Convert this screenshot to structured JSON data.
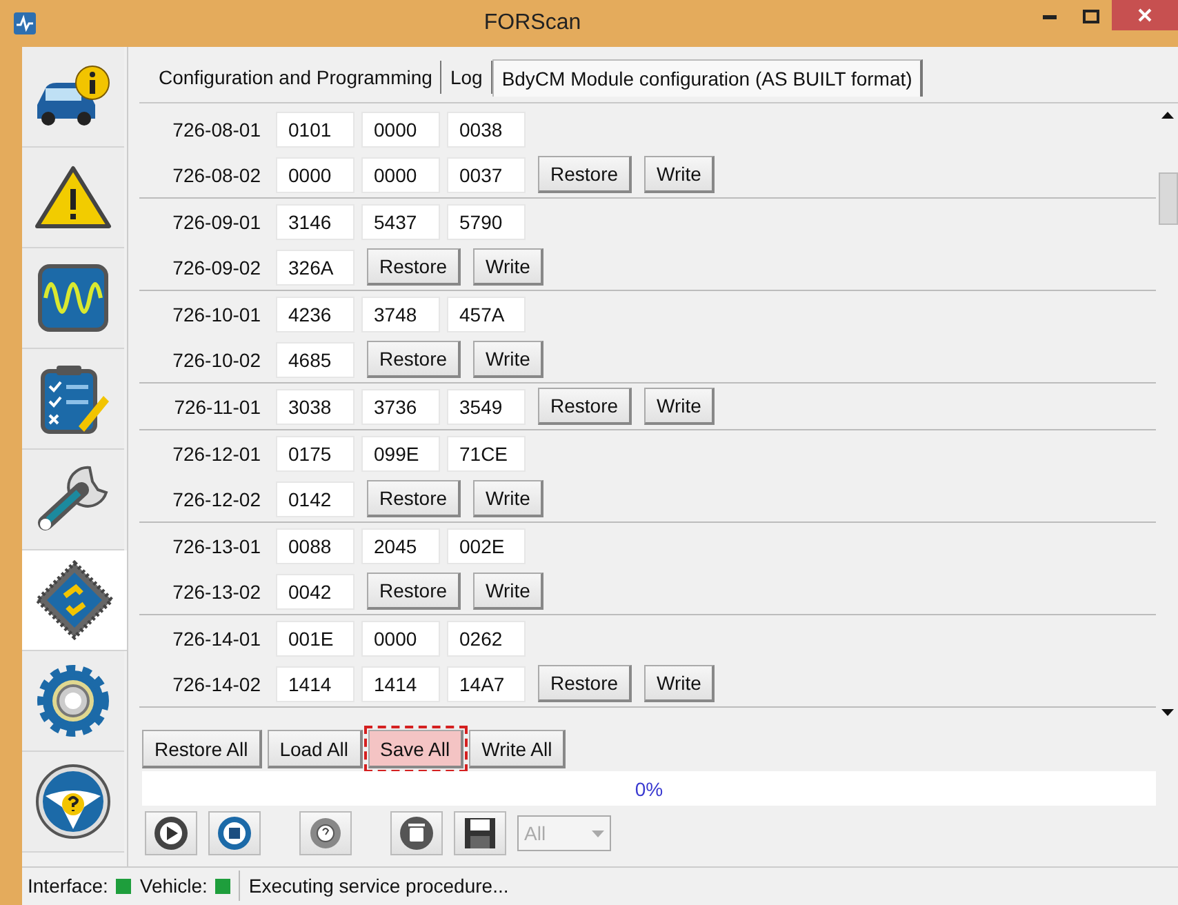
{
  "window": {
    "title": "FORScan"
  },
  "sidebar": {
    "items": [
      {
        "selected": false
      },
      {
        "selected": false
      },
      {
        "selected": false
      },
      {
        "selected": false
      },
      {
        "selected": false
      },
      {
        "selected": true
      },
      {
        "selected": false
      },
      {
        "selected": false
      }
    ]
  },
  "tabs": [
    {
      "label": "Configuration and Programming",
      "selected": false
    },
    {
      "label": "Log",
      "selected": false
    },
    {
      "label": "BdyCM Module configuration (AS BUILT format)",
      "selected": true
    }
  ],
  "groups": [
    {
      "rows": [
        {
          "address": "726-08-01",
          "values": [
            "0101",
            "0000",
            "0038"
          ],
          "buttons": []
        },
        {
          "address": "726-08-02",
          "values": [
            "0000",
            "0000",
            "0037"
          ],
          "buttons": [
            "Restore",
            "Write"
          ]
        }
      ]
    },
    {
      "rows": [
        {
          "address": "726-09-01",
          "values": [
            "3146",
            "5437",
            "5790"
          ],
          "buttons": []
        },
        {
          "address": "726-09-02",
          "values": [
            "326A"
          ],
          "buttons": [
            "Restore",
            "Write"
          ]
        }
      ]
    },
    {
      "rows": [
        {
          "address": "726-10-01",
          "values": [
            "4236",
            "3748",
            "457A"
          ],
          "buttons": []
        },
        {
          "address": "726-10-02",
          "values": [
            "4685"
          ],
          "buttons": [
            "Restore",
            "Write"
          ]
        }
      ]
    },
    {
      "rows": [
        {
          "address": "726-11-01",
          "values": [
            "3038",
            "3736",
            "3549"
          ],
          "buttons": [
            "Restore",
            "Write"
          ]
        }
      ]
    },
    {
      "rows": [
        {
          "address": "726-12-01",
          "values": [
            "0175",
            "099E",
            "71CE"
          ],
          "buttons": []
        },
        {
          "address": "726-12-02",
          "values": [
            "0142"
          ],
          "buttons": [
            "Restore",
            "Write"
          ]
        }
      ]
    },
    {
      "rows": [
        {
          "address": "726-13-01",
          "values": [
            "0088",
            "2045",
            "002E"
          ],
          "buttons": []
        },
        {
          "address": "726-13-02",
          "values": [
            "0042"
          ],
          "buttons": [
            "Restore",
            "Write"
          ]
        }
      ]
    },
    {
      "rows": [
        {
          "address": "726-14-01",
          "values": [
            "001E",
            "0000",
            "0262"
          ],
          "buttons": []
        },
        {
          "address": "726-14-02",
          "values": [
            "1414",
            "1414",
            "14A7"
          ],
          "buttons": [
            "Restore",
            "Write"
          ]
        }
      ]
    }
  ],
  "actions": [
    {
      "label": "Restore All",
      "highlighted": false
    },
    {
      "label": "Load All",
      "highlighted": false
    },
    {
      "label": "Save All",
      "highlighted": true
    },
    {
      "label": "Write All",
      "highlighted": false
    }
  ],
  "progress": {
    "level": 0,
    "reading": "0%"
  },
  "toolbar": {
    "dropdown": {
      "value": "All",
      "disabled": true
    }
  },
  "status_bar": {
    "indicators": [
      {
        "label": "Interface:",
        "color": "#1e9e3c"
      },
      {
        "label": "Vehicle:",
        "color": "#1e9e3c"
      }
    ],
    "message": "Executing service procedure..."
  }
}
